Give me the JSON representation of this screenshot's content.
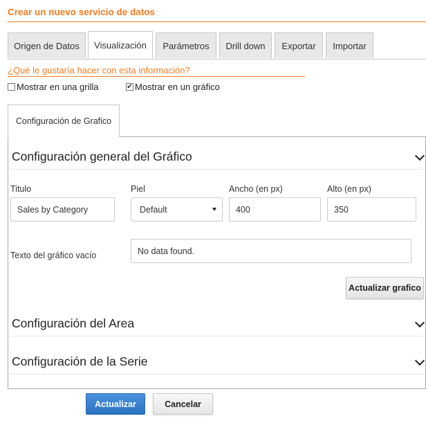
{
  "header": {
    "title": "Crear un nuevo servicio de datos"
  },
  "tabs": [
    {
      "label": "Origen de Datos"
    },
    {
      "label": "Visualización"
    },
    {
      "label": "Parámetros"
    },
    {
      "label": "Drill down"
    },
    {
      "label": "Exportar"
    },
    {
      "label": "Importar"
    }
  ],
  "active_tab": "Visualización",
  "question": "¿Qué le gustaría hacer con esta información?",
  "options": {
    "grid": {
      "label": "Mostrar en una grilla",
      "checked": false
    },
    "chart": {
      "label": "Mostrar en un gráfico",
      "checked": true
    }
  },
  "subtab": {
    "label": "Configuración de Grafico"
  },
  "general_section": {
    "title": "Configuración general del Gráfico",
    "fields": {
      "title": {
        "label": "Titulo",
        "value": "Sales by Category"
      },
      "skin": {
        "label": "Piel",
        "value": "Default"
      },
      "width": {
        "label": "Ancho (en px)",
        "value": "400"
      },
      "height": {
        "label": "Alto (en px)",
        "value": "350"
      },
      "empty_text": {
        "label": "Texto del gráfico vacío",
        "value": "No data found."
      }
    },
    "refresh_button": "Actualizar grafico"
  },
  "area_section": {
    "title": "Configuración del Area"
  },
  "series_section": {
    "title": "Configuración de la Serie"
  },
  "footer": {
    "update_button": "Actualizar",
    "cancel_button": "Cancelar"
  },
  "colors": {
    "accent": "#f47c20",
    "primary_button": "#2a73c2"
  }
}
